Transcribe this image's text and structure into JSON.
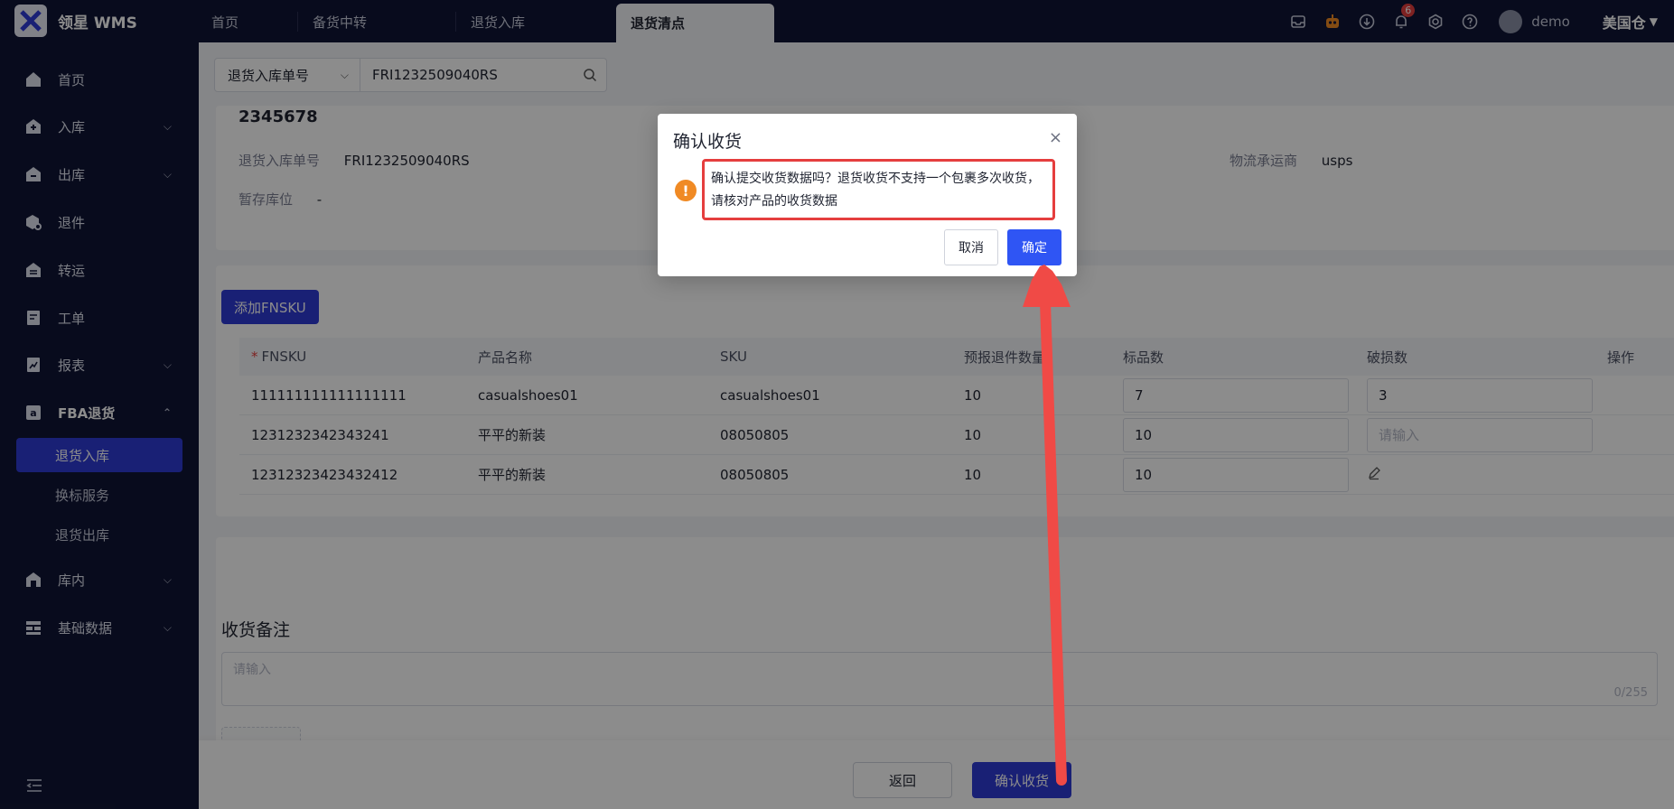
{
  "app": {
    "brand": "领星 WMS"
  },
  "tabs": [
    {
      "label": "首页"
    },
    {
      "label": "备货中转"
    },
    {
      "label": "退货入库"
    },
    {
      "label": "退货清点"
    }
  ],
  "topbar": {
    "notifications_count": "6",
    "user": "demo",
    "warehouse": "美国仓"
  },
  "sidebar": {
    "items": [
      {
        "label": "首页"
      },
      {
        "label": "入库"
      },
      {
        "label": "出库"
      },
      {
        "label": "退件"
      },
      {
        "label": "转运"
      },
      {
        "label": "工单"
      },
      {
        "label": "报表"
      },
      {
        "label": "FBA退货"
      },
      {
        "label": "库内"
      },
      {
        "label": "基础数据"
      }
    ],
    "sub_items": [
      {
        "label": "退货入库"
      },
      {
        "label": "换标服务"
      },
      {
        "label": "退货出库"
      }
    ]
  },
  "search": {
    "type_label": "退货入库单号",
    "value": "FRI1232509040RS"
  },
  "detail": {
    "title": "2345678",
    "return_no_label": "退货入库单号",
    "return_no_value": "FRI1232509040RS",
    "temp_loc_label": "暂存库位",
    "temp_loc_value": "-",
    "carrier_label": "物流承运商",
    "carrier_value": "usps"
  },
  "products": {
    "add_button": "添加FNSKU",
    "columns": [
      "FNSKU",
      "产品名称",
      "SKU",
      "预报退件数量",
      "标品数",
      "破损数",
      "操作"
    ],
    "rows": [
      {
        "fnsku": "111111111111111111",
        "name": "casualshoes01",
        "sku": "casualshoes01",
        "forecast": "10",
        "good": "7",
        "damaged": "3"
      },
      {
        "fnsku": "1231232342343241",
        "name": "平平的新装",
        "sku": "08050805",
        "forecast": "10",
        "good": "10",
        "damaged_placeholder": "请输入"
      },
      {
        "fnsku": "12312323423432412",
        "name": "平平的新装",
        "sku": "08050805",
        "forecast": "10",
        "good": "10",
        "damaged": ""
      }
    ]
  },
  "remark": {
    "title": "收货备注",
    "placeholder": "请输入",
    "count": "0/255"
  },
  "footer": {
    "back": "返回",
    "confirm": "确认收货"
  },
  "dialog": {
    "title": "确认收货",
    "message": "确认提交收货数据吗？退货收货不支持一个包裹多次收货，请核对产品的收货数据",
    "cancel": "取消",
    "ok": "确定"
  },
  "colors": {
    "primary": "#2f3bd6",
    "sidebar_bg": "#101535",
    "warning": "#f08a24",
    "highlight": "#e53e3e"
  }
}
